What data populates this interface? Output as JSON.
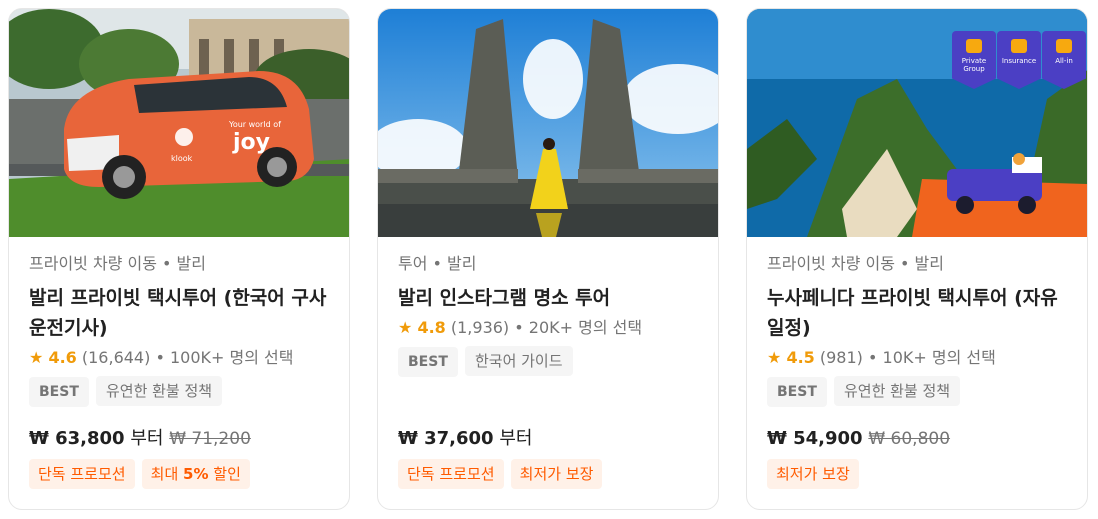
{
  "cards": [
    {
      "category": "프라이빗 차량 이동 • 발리",
      "title": "발리 프라이빗 택시투어 (한국어 구사 운전기사)",
      "rating_star": "★",
      "rating_score": "4.6",
      "rating_count": "(16,644)",
      "rating_booked": "• 100K+ 명의 선택",
      "tags": [
        "BEST",
        "유연한 환불 정책"
      ],
      "price_now": "₩ 63,800",
      "price_suffix": "부터",
      "price_old": "₩ 71,200",
      "promo_1": "단독 프로모션",
      "promo_2_prefix": "최대 ",
      "promo_2_bold": "5%",
      "promo_2_suffix": " 할인",
      "image_text_brand": "klook",
      "image_text_slogan": "Your world of",
      "image_text_joy": "joy"
    },
    {
      "category": "투어 • 발리",
      "title": "발리 인스타그램 명소 투어",
      "rating_star": "★",
      "rating_score": "4.8",
      "rating_count": "(1,936)",
      "rating_booked": "• 20K+ 명의 선택",
      "tags": [
        "BEST",
        "한국어 가이드"
      ],
      "price_now": "₩ 37,600",
      "price_suffix": "부터",
      "promo_1": "단독 프로모션",
      "promo_2": "최저가 보장"
    },
    {
      "category": "프라이빗 차량 이동 • 발리",
      "title": "누사페니다 프라이빗 택시투어 (자유일정)",
      "rating_star": "★",
      "rating_score": "4.5",
      "rating_count": "(981)",
      "rating_booked": "• 10K+ 명의 선택",
      "tags": [
        "BEST",
        "유연한 환불 정책"
      ],
      "price_now": "₩ 54,900",
      "price_old": "₩ 60,800",
      "promo_1": "최저가 보장",
      "badges": [
        "Private Group",
        "Insurance",
        "All-in"
      ]
    }
  ]
}
